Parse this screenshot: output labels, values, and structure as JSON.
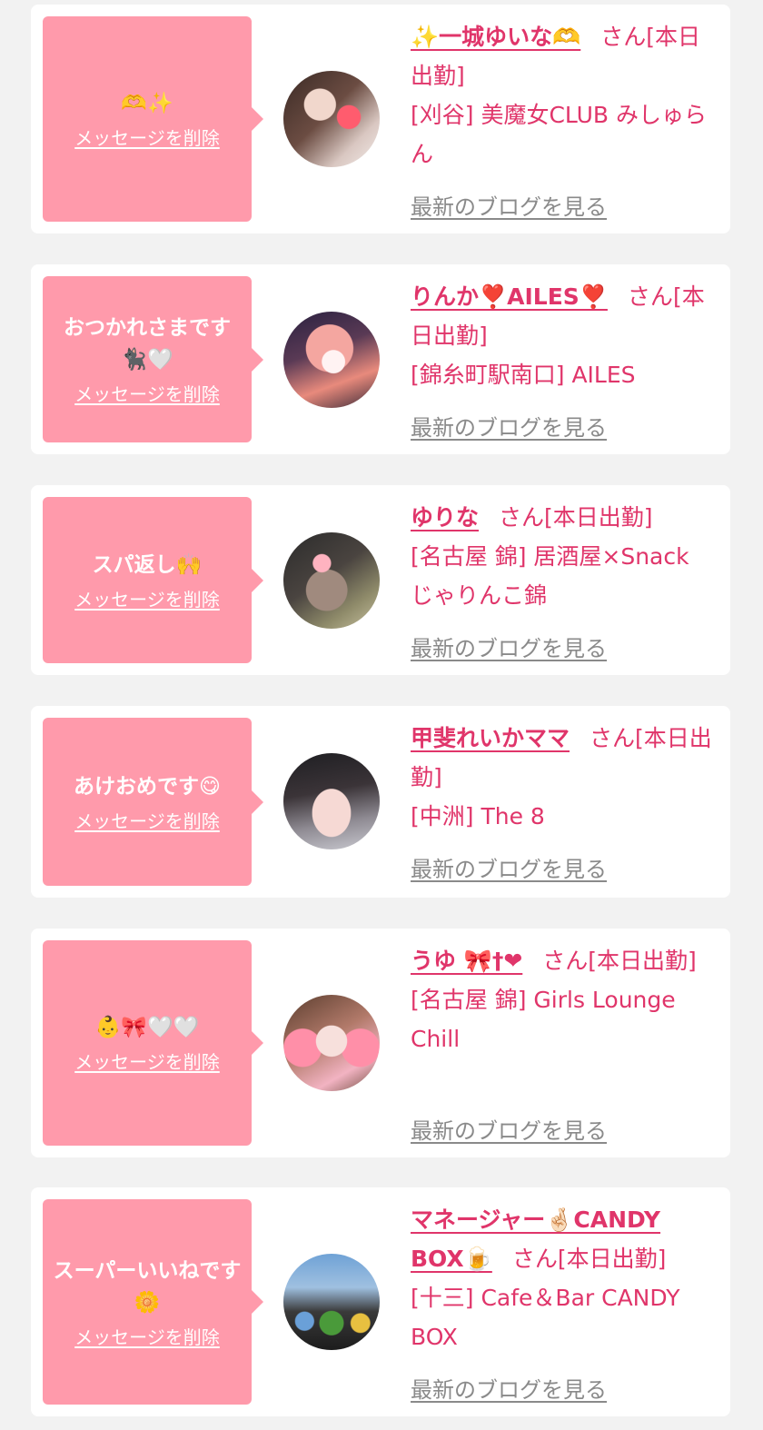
{
  "delete_label": "メッセージを削除",
  "blog_label": "最新のブログを見る",
  "san_suffix": "さん",
  "status": "[本日出勤]",
  "colors": {
    "accent": "#e0356a",
    "bubble": "#ff9aab",
    "background": "#f2f2f2",
    "link_gray": "#8a8a8a"
  },
  "items": [
    {
      "message": "🫶✨",
      "name": "✨一城ゆいな🫶",
      "shop": "[刈谷] 美魔女CLUB みしゅらん"
    },
    {
      "message": "おつかれさまです🐈‍⬛🤍",
      "name": "りんか❣️AILES❣️",
      "shop": "[錦糸町駅南口] AILES"
    },
    {
      "message": "スパ返し🙌",
      "name": "ゆりな",
      "shop": "[名古屋 錦] 居酒屋×Snack じゃりんこ錦"
    },
    {
      "message": "あけおめです😋",
      "name": "甲斐れいかママ",
      "shop": "[中洲] The 8"
    },
    {
      "message": "👶🎀🤍🤍",
      "name": "うゆ 🎀†❤",
      "shop": "[名古屋 錦] Girls Lounge Chill"
    },
    {
      "message": "スーパーいいねです🌼",
      "name": "マネージャー🤞🏻CANDY BOX🍺",
      "shop": "[十三] Cafe＆Bar CANDY BOX"
    }
  ]
}
